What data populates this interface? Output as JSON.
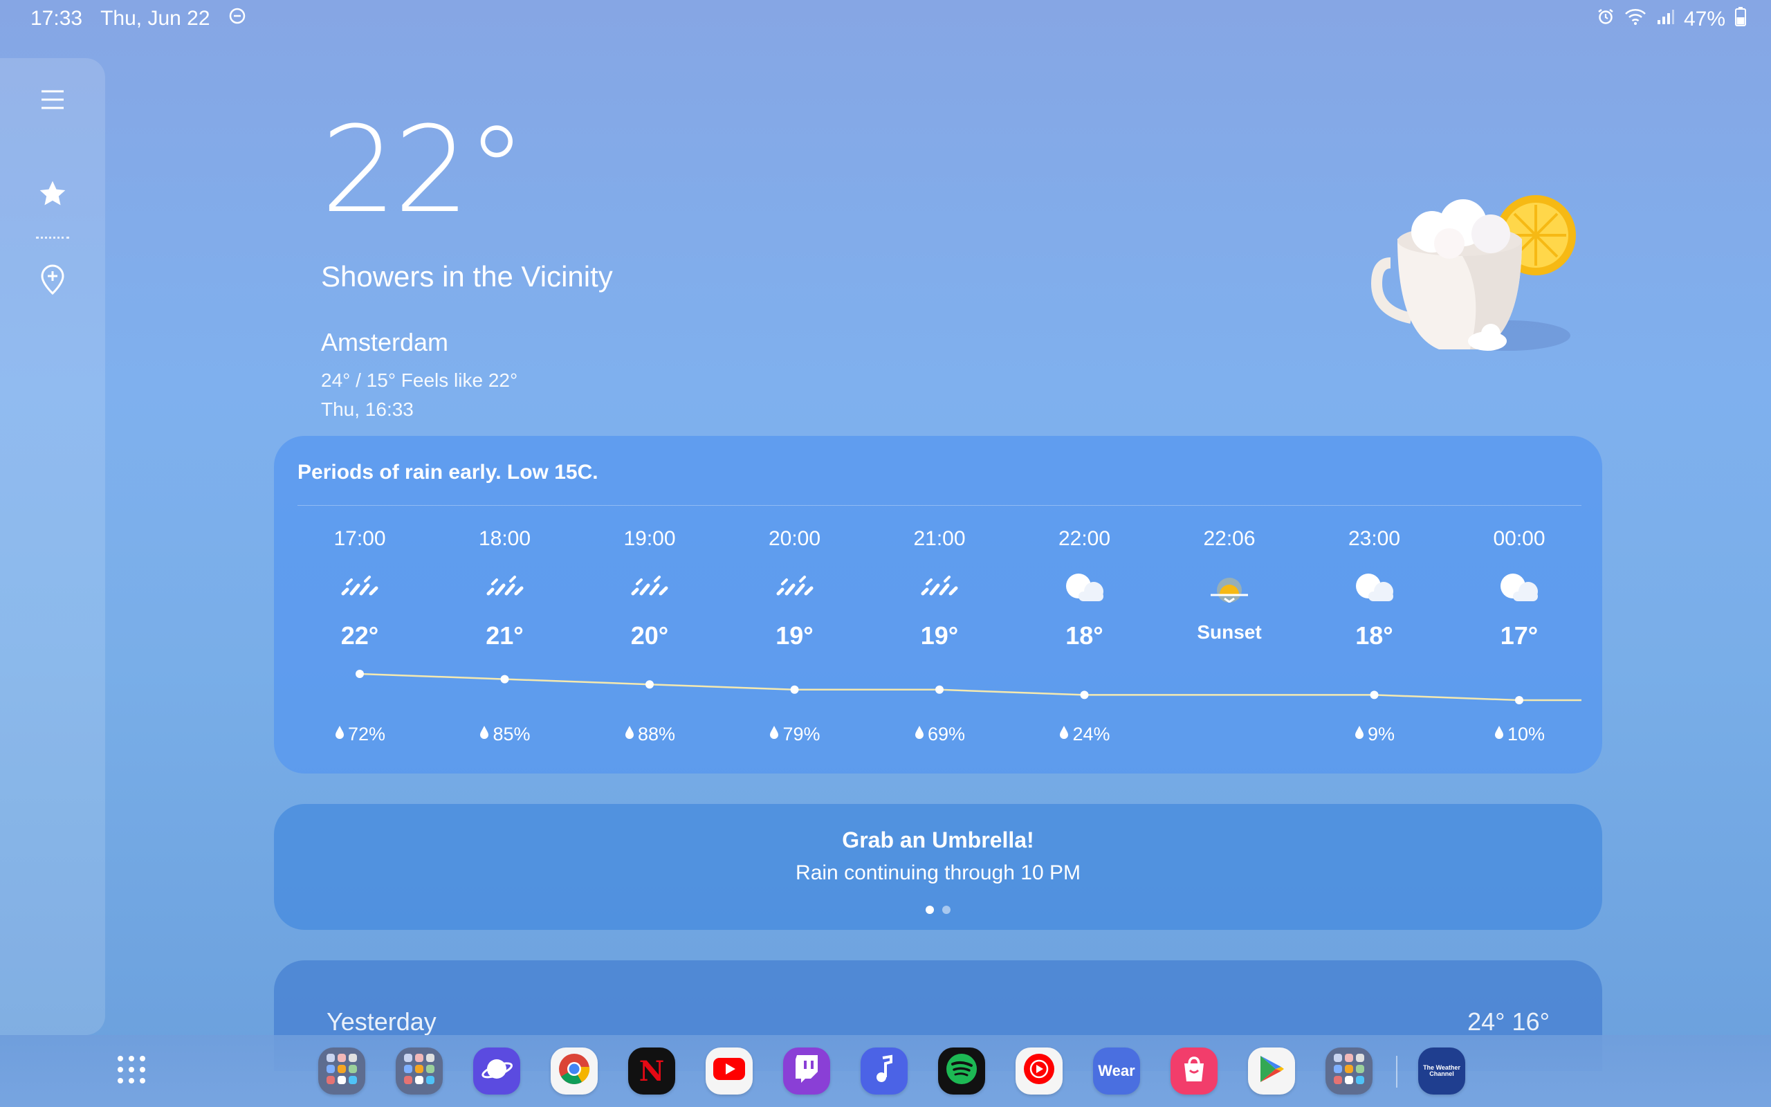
{
  "status_bar": {
    "time": "17:33",
    "date": "Thu, Jun 22",
    "battery": "47%"
  },
  "current": {
    "temperature": "22°",
    "condition": "Showers in the Vicinity",
    "city": "Amsterdam",
    "range_feels": "24° / 15° Feels like 22°",
    "updated": "Thu, 16:33"
  },
  "hourly": {
    "summary": "Periods of rain early. Low 15C.",
    "items": [
      {
        "time": "17:00",
        "icon": "rain-icon",
        "temp": "22°",
        "precip": "72%",
        "value": 22
      },
      {
        "time": "18:00",
        "icon": "rain-icon",
        "temp": "21°",
        "precip": "85%",
        "value": 21
      },
      {
        "time": "19:00",
        "icon": "rain-icon",
        "temp": "20°",
        "precip": "88%",
        "value": 20
      },
      {
        "time": "20:00",
        "icon": "rain-icon",
        "temp": "19°",
        "precip": "79%",
        "value": 19
      },
      {
        "time": "21:00",
        "icon": "rain-icon",
        "temp": "19°",
        "precip": "69%",
        "value": 19
      },
      {
        "time": "22:00",
        "icon": "cloudy-night-icon",
        "temp": "18°",
        "precip": "24%",
        "value": 18
      },
      {
        "time": "22:06",
        "icon": "sunset-icon",
        "label": "Sunset"
      },
      {
        "time": "23:00",
        "icon": "cloudy-night-icon",
        "temp": "18°",
        "precip": "9%",
        "value": 18
      },
      {
        "time": "00:00",
        "icon": "cloudy-night-icon",
        "temp": "17°",
        "precip": "10%",
        "value": 17
      }
    ]
  },
  "alert": {
    "title": "Grab an Umbrella!",
    "subtitle": "Rain continuing through 10 PM",
    "page": 1,
    "pages": 2
  },
  "yesterday": {
    "label": "Yesterday",
    "temps": "24° 16°"
  },
  "taskbar": {
    "apps": [
      {
        "name": "folder-1",
        "icon": "folder-icon"
      },
      {
        "name": "folder-2",
        "icon": "folder-icon"
      },
      {
        "name": "samsung-internet",
        "icon": "planet-icon"
      },
      {
        "name": "chrome",
        "icon": "chrome-icon"
      },
      {
        "name": "netflix",
        "icon": "netflix-icon",
        "text": "N"
      },
      {
        "name": "youtube",
        "icon": "youtube-icon"
      },
      {
        "name": "twitch",
        "icon": "twitch-icon"
      },
      {
        "name": "music",
        "icon": "music-note-icon"
      },
      {
        "name": "spotify",
        "icon": "spotify-icon"
      },
      {
        "name": "youtube-music",
        "icon": "youtube-music-icon"
      },
      {
        "name": "wear",
        "icon": "wear-icon",
        "text": "Wear"
      },
      {
        "name": "galaxy-store",
        "icon": "shopping-bag-icon"
      },
      {
        "name": "play-store",
        "icon": "play-store-icon"
      },
      {
        "name": "folder-3",
        "icon": "folder-icon"
      }
    ],
    "pinned": {
      "name": "the-weather-channel",
      "icon": "weather-channel-icon",
      "text": "The Weather Channel"
    }
  },
  "colors": {
    "accent": "#5a9cf0",
    "graph_line": "#f4e9b0",
    "sun": "#f6b914"
  }
}
